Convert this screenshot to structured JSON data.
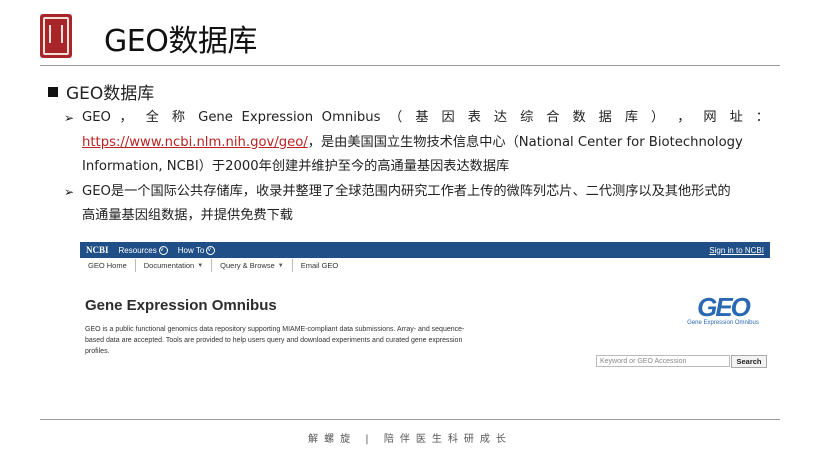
{
  "header": {
    "title": "GEO数据库"
  },
  "section": {
    "title": "GEO数据库"
  },
  "bullets": {
    "b1_line1": "GEO ， 全 称 Gene Expression Omnibus （ 基 因 表 达 综 合 数 据 库 ） ， 网 址 ：",
    "b1_url": "https://www.ncbi.nlm.nih.gov/geo/",
    "b1_line2_rest": "，是由美国国立生物技术信息中心（National Center for Biotechnology",
    "b1_line3": "Information, NCBI）于2000年创建并维护至今的高通量基因表达数据库",
    "b2_line1": "GEO是一个国际公共存储库，收录并整理了全球范围内研究工作者上传的微阵列芯片、二代测序以及其他形式的",
    "b2_line2": "高通量基因组数据，并提供免费下载"
  },
  "screenshot": {
    "ncbi_logo": "NCBI",
    "resources": "Resources",
    "how_to": "How To",
    "sign_in": "Sign in to NCBI",
    "tabs": [
      "GEO Home",
      "Documentation",
      "Query & Browse",
      "Email GEO"
    ],
    "heading": "Gene Expression Omnibus",
    "description": "GEO is a public functional genomics data repository supporting MIAME-compliant data submissions. Array- and sequence-based data are accepted. Tools are provided to help users query and download experiments and curated gene expression profiles.",
    "geo_logo_text": "GEO",
    "geo_logo_sub": "Gene Expression Omnibus",
    "search_placeholder": "Keyword or GEO Accession",
    "search_button": "Search"
  },
  "footer": {
    "text": "解螺旋 | 陪伴医生科研成长"
  },
  "colors": {
    "ncbi_bar": "#1f4f86",
    "url": "#b22222",
    "geo_blue": "#2a68b4",
    "logo": "#a8262a"
  }
}
